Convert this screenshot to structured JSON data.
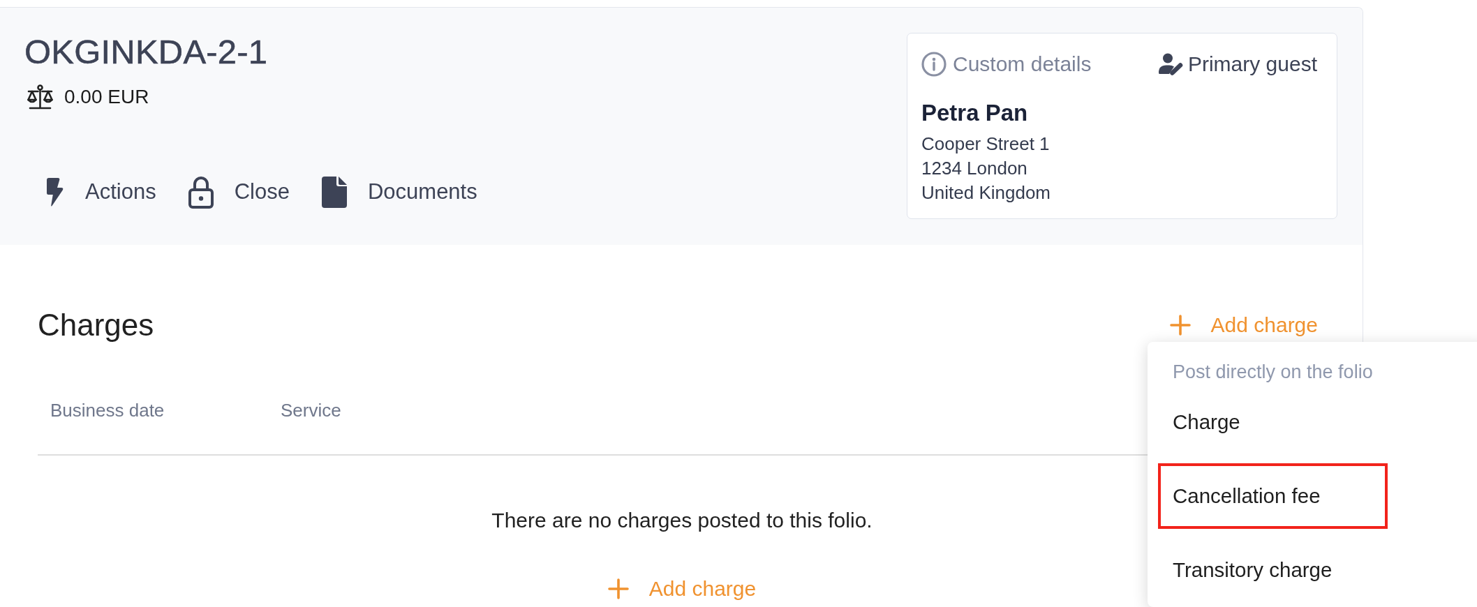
{
  "header": {
    "title": "OKGINKDA-2-1",
    "balance": "0.00 EUR",
    "actions": [
      {
        "label": "Actions",
        "kind": "actions"
      },
      {
        "label": "Close",
        "kind": "close"
      },
      {
        "label": "Documents",
        "kind": "documents"
      }
    ]
  },
  "guest_card": {
    "custom_details": "Custom details",
    "primary_guest": "Primary guest",
    "name": "Petra Pan",
    "address": [
      "Cooper Street 1",
      "1234 London",
      "United Kingdom"
    ]
  },
  "charges": {
    "title": "Charges",
    "add_button": "Add charge",
    "columns": [
      "Business date",
      "Service"
    ],
    "empty_message": "There are no charges posted to this folio.",
    "empty_add_button": "Add charge"
  },
  "menu": {
    "heading": "Post directly on the folio",
    "items": [
      {
        "label": "Charge",
        "highlighted": false
      },
      {
        "label": "Cancellation fee",
        "highlighted": true
      },
      {
        "label": "Transitory charge",
        "highlighted": false
      }
    ]
  }
}
